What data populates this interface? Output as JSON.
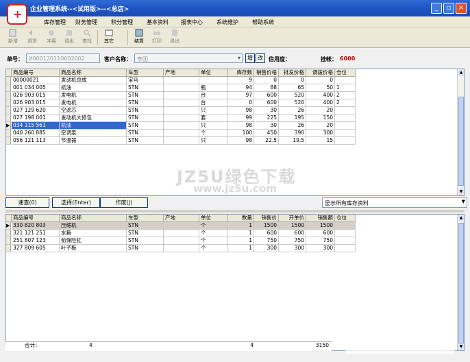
{
  "window": {
    "title": "企业管理系统--<试用版>--<总店>"
  },
  "menu": [
    "库存管理",
    "财务管理",
    "积分管理",
    "基本资料",
    "报表中心",
    "系统维护",
    "帮助系统"
  ],
  "toolbar": [
    "新增",
    "退货",
    "冲离",
    "调出",
    "查找",
    "其它",
    "结算",
    "打印",
    "退出"
  ],
  "info": {
    "order_label": "单号：",
    "order_no": "X000120110602002",
    "customer_label": "客户名称：",
    "customer": "李团",
    "btn_add": "增",
    "btn_change": "改",
    "credit_label": "信用度：",
    "debt_label": "挂帐：",
    "debt_value": "6000"
  },
  "top_grid": {
    "columns": [
      "商品编号",
      "商品名称",
      "车型",
      "产地",
      "单位",
      "库存数",
      "销售价格",
      "批发价格",
      "调拨价格",
      "仓位"
    ],
    "rows": [
      [
        "00000021",
        "发动机总成",
        "宝马",
        "",
        "",
        "9",
        "0",
        "0",
        "0",
        ""
      ],
      [
        "001 034 005",
        "机油",
        "STN",
        "",
        "瓶",
        "94",
        "88",
        "65",
        "50",
        "1"
      ],
      [
        "026 903 015",
        "发电机",
        "STN",
        "",
        "台",
        "97",
        "600",
        "520",
        "400",
        "2"
      ],
      [
        "026 903 015",
        "发电机",
        "STN",
        "",
        "台",
        "0",
        "600",
        "520",
        "400",
        "2"
      ],
      [
        "027 129 620",
        "空滤芯",
        "STN",
        "",
        "只",
        "98",
        "30",
        "26",
        "20",
        ""
      ],
      [
        "027 198 001",
        "发动机大修包",
        "STN",
        "",
        "套",
        "99",
        "225",
        "195",
        "150",
        ""
      ],
      [
        "034 115 561",
        "机油",
        "STN",
        "",
        "只",
        "98",
        "30",
        "26",
        "20",
        ""
      ],
      [
        "040 260 885",
        "空调泵",
        "STN",
        "",
        "个",
        "100",
        "450",
        "390",
        "300",
        ""
      ],
      [
        "056 121 113",
        "节温器",
        "STN",
        "",
        "只",
        "98",
        "22.5",
        "19.5",
        "15",
        ""
      ]
    ]
  },
  "mid_buttons": {
    "quick": "速查(0)",
    "choose": "选择(Enter)",
    "void": "作废(J)"
  },
  "filter_select": "显示所有库存资料",
  "bottom_grid": {
    "columns": [
      "商品编号",
      "商品名称",
      "车型",
      "产地",
      "单位",
      "数量",
      "销售价",
      "开单价",
      "销售额",
      "仓位"
    ],
    "rows": [
      [
        "330 820 803",
        "压缩机",
        "STN",
        "",
        "个",
        "1",
        "1500",
        "1500",
        "1500",
        ""
      ],
      [
        "321 121 251",
        "水箱",
        "STN",
        "",
        "个",
        "1",
        "600",
        "600",
        "600",
        ""
      ],
      [
        "251 807 123",
        "前保险杠",
        "STN",
        "",
        "个",
        "1",
        "750",
        "750",
        "750",
        ""
      ],
      [
        "327 809 605",
        "叶子板",
        "STN",
        "",
        "个",
        "1",
        "300",
        "300",
        "300",
        ""
      ]
    ]
  },
  "totals": {
    "label": "合计：",
    "count": "4",
    "qty": "4",
    "amount": "3150"
  },
  "watermark": {
    "big": "JZ5U绿色下载",
    "small": "www.jz5u.com"
  }
}
